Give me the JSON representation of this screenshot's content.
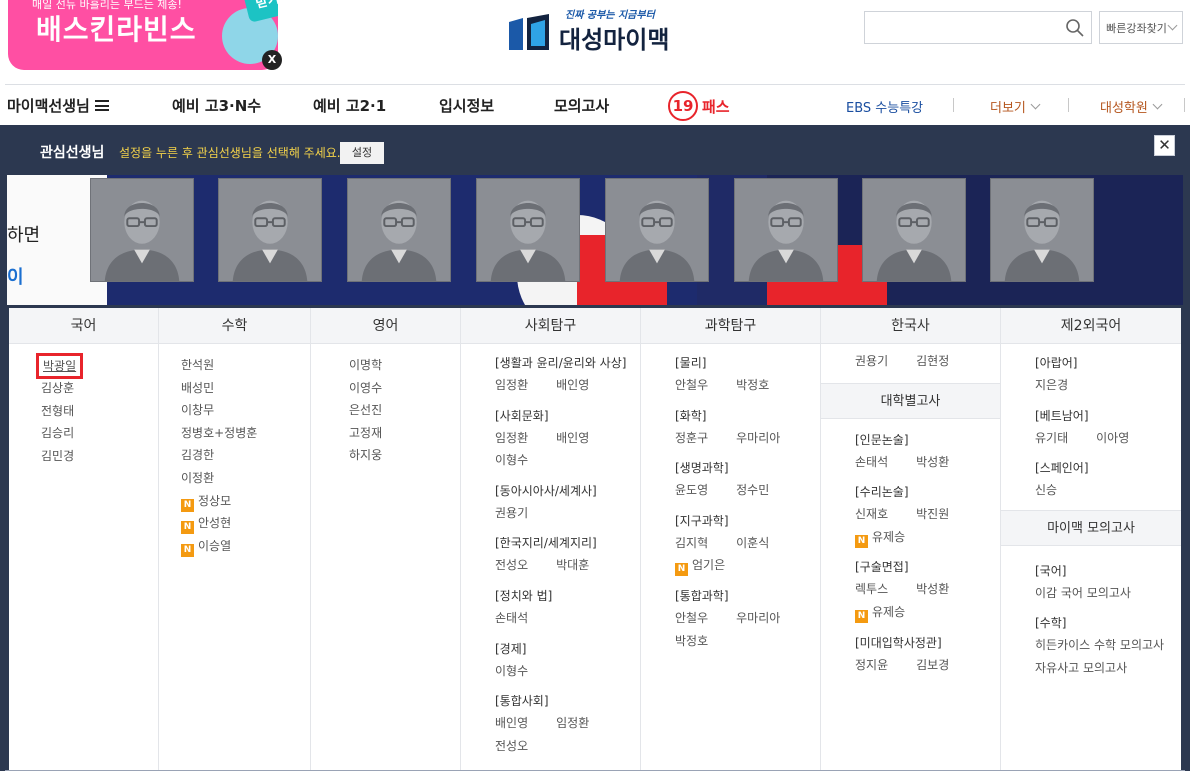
{
  "header": {
    "promo": {
      "small_text": "매일 선뉴 바흘리는 부드는 제송!",
      "title": "배스킨라빈스",
      "tag": "받기",
      "close_label": "X"
    },
    "logo": {
      "tagline": "진짜 공부는 지금부터",
      "name": "대성마이맥"
    },
    "search": {
      "placeholder": "",
      "value": ""
    },
    "quick_find": "빠른강좌찾기"
  },
  "nav": {
    "teachers": "마이맥선생님",
    "items": [
      "예비 고3·N수",
      "예비 고2·1",
      "입시정보",
      "모의고사"
    ],
    "pass_badge": "19",
    "pass_label": "패스",
    "ebs": "EBS 수능특강",
    "more": "더보기",
    "daesung": "대성학원"
  },
  "panel": {
    "title": "관심선생님",
    "hint": "설정을 누른 후 관심선생님을 선택해 주세요.",
    "setting_button": "설정",
    "close_label": "✕",
    "banner_left_text1": "하면",
    "banner_left_text2": "이",
    "photo_count": 8
  },
  "subjects": {
    "korean": {
      "header": "국어",
      "names": [
        "박광일",
        "김상훈",
        "전형태",
        "김승리",
        "김민경"
      ]
    },
    "math": {
      "header": "수학",
      "names": [
        "한석원",
        "배성민",
        "이창무",
        "정병호+정병훈",
        "김경한",
        "이정환"
      ],
      "new_names": [
        "정상모",
        "안성현",
        "이승열"
      ]
    },
    "english": {
      "header": "영어",
      "names": [
        "이명학",
        "이영수",
        "은선진",
        "고정재",
        "하지웅"
      ]
    },
    "social": {
      "header": "사회탐구",
      "groups": [
        {
          "title": "[생활과 윤리/윤리와 사상]",
          "names": [
            "임정환",
            "배인영"
          ]
        },
        {
          "title": "[사회문화]",
          "names": [
            "임정환",
            "배인영",
            "이형수"
          ]
        },
        {
          "title": "[동아시아사/세계사]",
          "names": [
            "권용기"
          ]
        },
        {
          "title": "[한국지리/세계지리]",
          "names": [
            "전성오",
            "박대훈"
          ]
        },
        {
          "title": "[정치와 법]",
          "names": [
            "손태석"
          ]
        },
        {
          "title": "[경제]",
          "names": [
            "이형수"
          ]
        },
        {
          "title": "[통합사회]",
          "names": [
            "배인영",
            "임정환",
            "전성오"
          ]
        }
      ]
    },
    "science": {
      "header": "과학탐구",
      "groups": [
        {
          "title": "[물리]",
          "names": [
            "안철우",
            "박정호"
          ]
        },
        {
          "title": "[화학]",
          "names": [
            "정훈구",
            "우마리아"
          ]
        },
        {
          "title": "[생명과학]",
          "names": [
            "윤도영",
            "정수민"
          ]
        },
        {
          "title": "[지구과학]",
          "names": [
            "김지혁",
            "이훈식"
          ],
          "new_names": [
            "엄기은"
          ]
        },
        {
          "title": "[통합과학]",
          "names": [
            "안철우",
            "우마리아",
            "박정호"
          ]
        }
      ]
    },
    "history": {
      "header": "한국사",
      "names": [
        "권용기",
        "김현정"
      ],
      "sub_header": "대학별고사",
      "groups": [
        {
          "title": "[인문논술]",
          "names": [
            "손태석",
            "박성환"
          ]
        },
        {
          "title": "[수리논술]",
          "names": [
            "신재호",
            "박진원"
          ],
          "new_names": [
            "유제승"
          ]
        },
        {
          "title": "[구술면접]",
          "names": [
            "렉투스",
            "박성환"
          ],
          "new_names": [
            "유제승"
          ]
        },
        {
          "title": "[미대입학사정관]",
          "names": [
            "정지윤",
            "김보경"
          ]
        }
      ]
    },
    "foreign": {
      "header": "제2외국어",
      "groups": [
        {
          "title": "[아랍어]",
          "names": [
            "지은경"
          ]
        },
        {
          "title": "[베트남어]",
          "names": [
            "유기태",
            "이아영"
          ]
        },
        {
          "title": "[스페인어]",
          "names": [
            "신승"
          ]
        }
      ],
      "sub_header": "마이맥 모의고사",
      "mock_groups": [
        {
          "title": "[국어]",
          "names": [
            "이감 국어 모의고사"
          ]
        },
        {
          "title": "[수학]",
          "names": [
            "히든카이스 수학 모의고사",
            "자유사고 모의고사"
          ]
        }
      ]
    },
    "new_badge": "N"
  },
  "colors": {
    "panel_bg": "#2c3850",
    "hint": "#f4d34a",
    "pass_red": "#e8242b",
    "new_badge": "#f49a11",
    "ebs_blue": "#1a4ea0",
    "academy_brown": "#b5561e",
    "highlight_box": "#e8242b"
  }
}
